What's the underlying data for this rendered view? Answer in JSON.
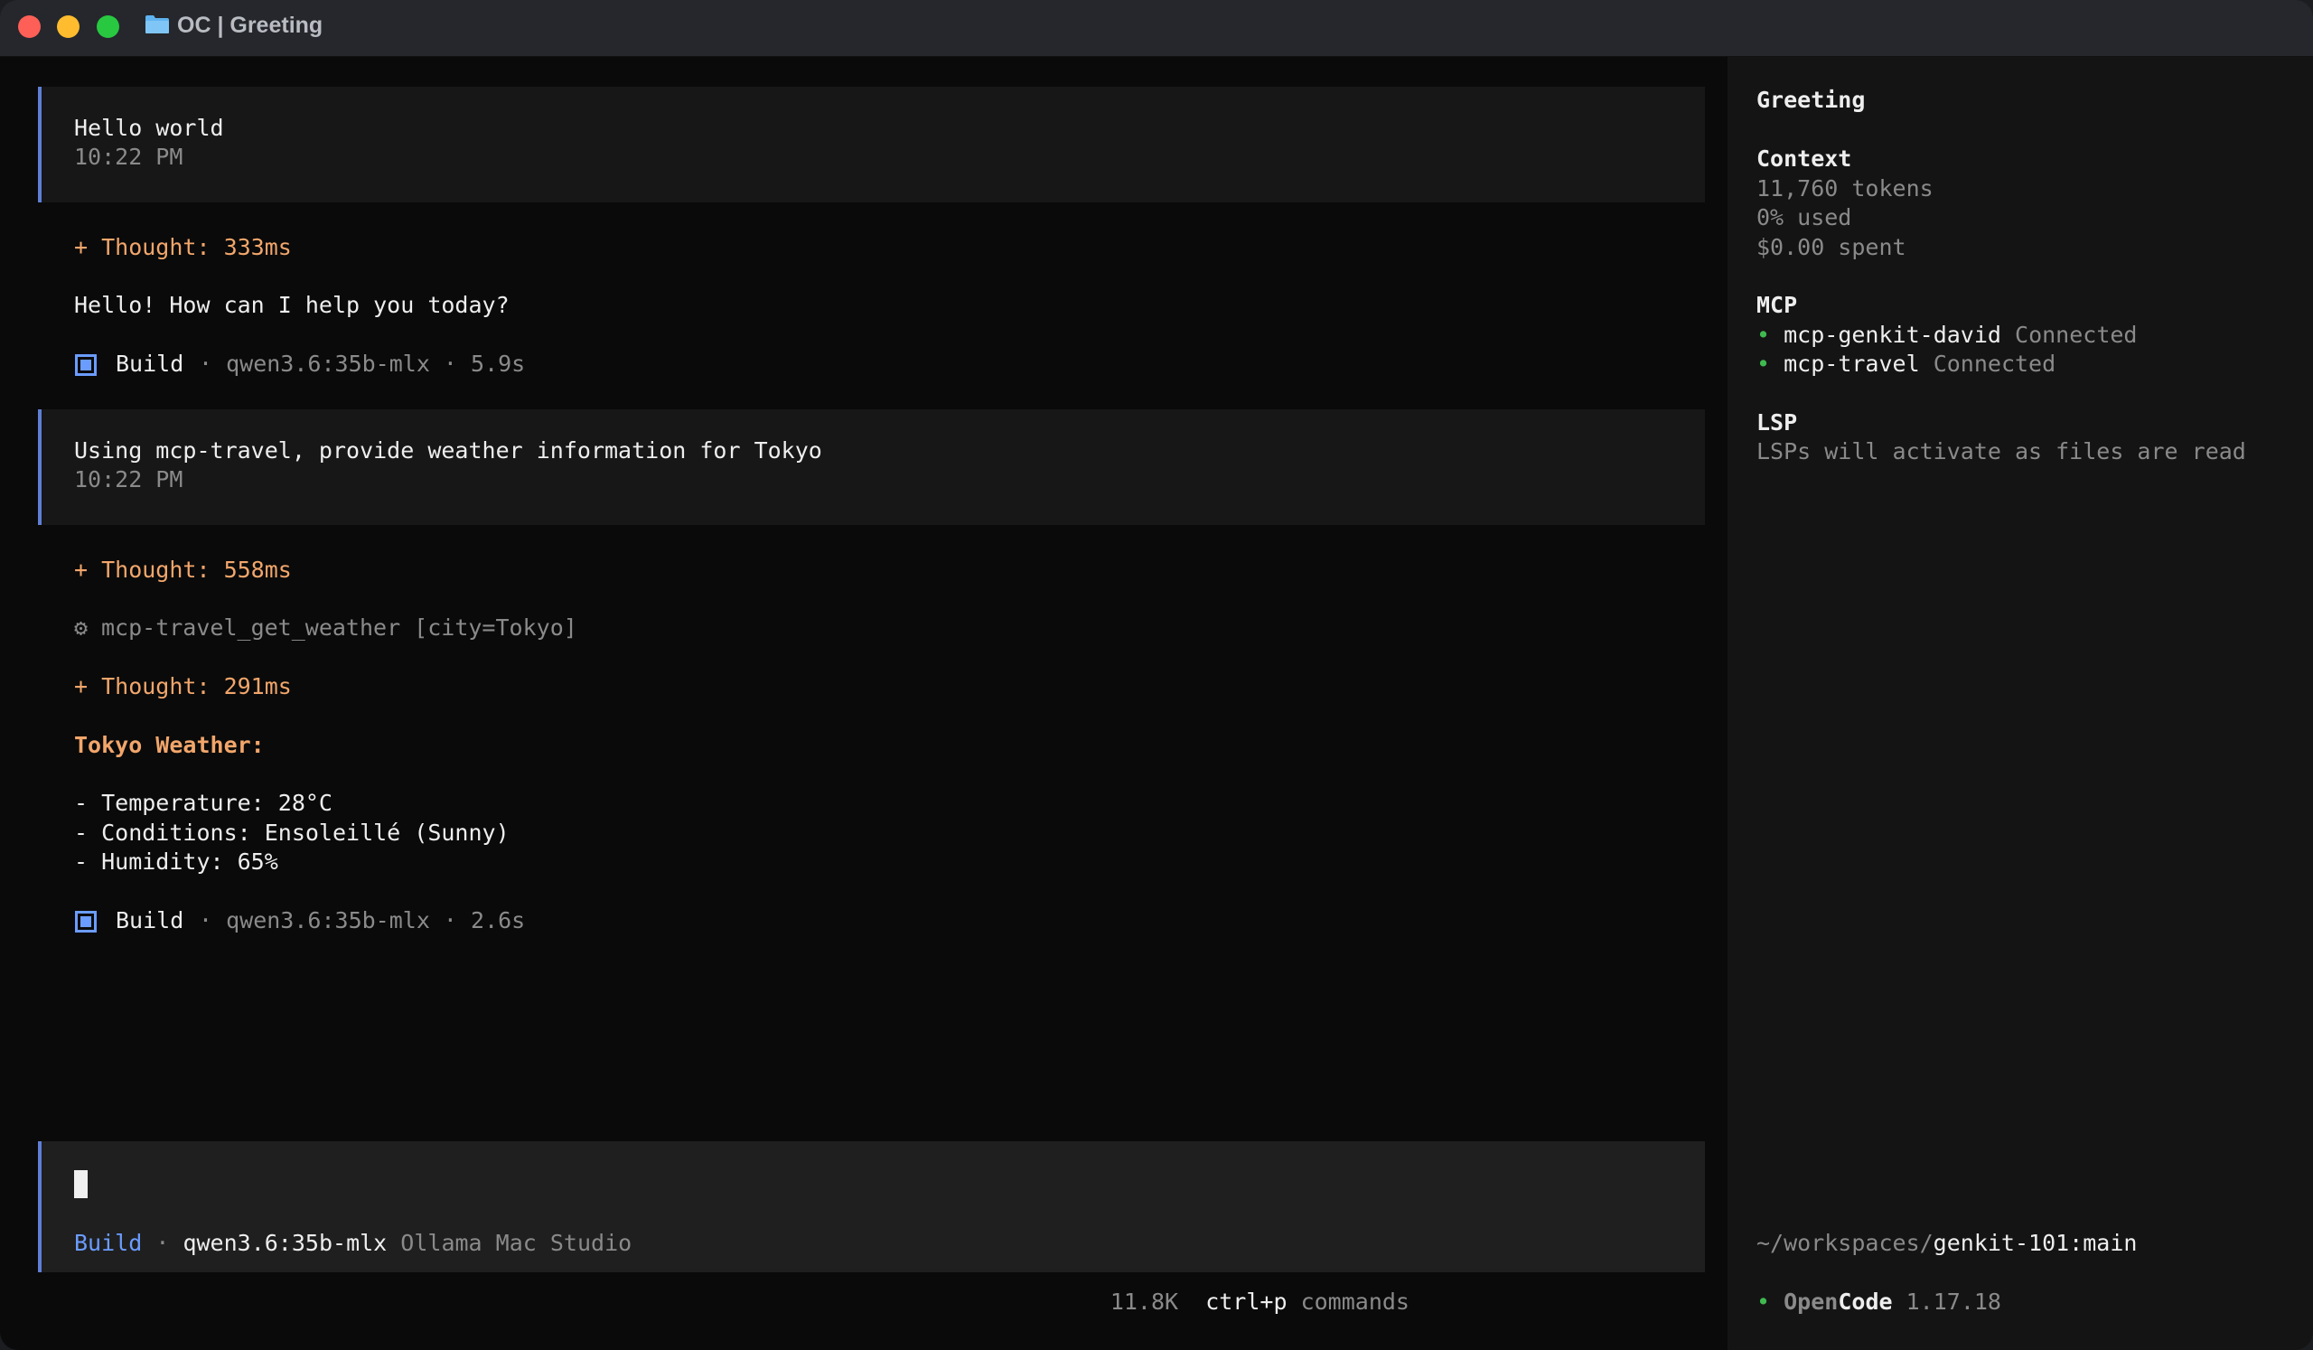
{
  "window": {
    "title": "OC | Greeting"
  },
  "messages": [
    {
      "text": "Hello world",
      "time": "10:22 PM"
    },
    {
      "text": "Using mcp-travel, provide weather information for Tokyo",
      "time": "10:22 PM"
    }
  ],
  "thoughts": [
    "+ Thought: 333ms",
    "+ Thought: 558ms",
    "+ Thought: 291ms"
  ],
  "reply1": "Hello! How can I help you today?",
  "builds": [
    {
      "label": "Build",
      "meta": "· qwen3.6:35b-mlx · 5.9s"
    },
    {
      "label": "Build",
      "meta": "· qwen3.6:35b-mlx · 2.6s"
    }
  ],
  "tool_call": "mcp-travel_get_weather [city=Tokyo]",
  "weather": {
    "heading": "Tokyo Weather:",
    "lines": [
      "- Temperature: 28°C",
      "- Conditions: Ensoleillé (Sunny)",
      "- Humidity: 65%"
    ]
  },
  "prompt": {
    "mode": "Build",
    "sep": "·",
    "model": "qwen3.6:35b-mlx",
    "provider": "Ollama Mac Studio"
  },
  "status": {
    "tokens": "11.8K",
    "shortcut": "ctrl+p",
    "shortcut_label": "commands"
  },
  "sidebar": {
    "session_title": "Greeting",
    "context": {
      "heading": "Context",
      "tokens": "11,760 tokens",
      "used": "0% used",
      "spent": "$0.00 spent"
    },
    "mcp": {
      "heading": "MCP",
      "servers": [
        {
          "name": "mcp-genkit-david",
          "status": "Connected"
        },
        {
          "name": "mcp-travel",
          "status": "Connected"
        }
      ]
    },
    "lsp": {
      "heading": "LSP",
      "message": "LSPs will activate as files are read"
    },
    "path": {
      "prefix": "~/workspaces/",
      "repo": "genkit-101:main"
    },
    "app": {
      "name_a": "Open",
      "name_b": "Code",
      "version": "1.17.18"
    }
  },
  "colors": {
    "accent": "#6b9cff",
    "thought": "#f2a66b",
    "connected": "#3fb950",
    "bar": "#5f7fd6"
  }
}
